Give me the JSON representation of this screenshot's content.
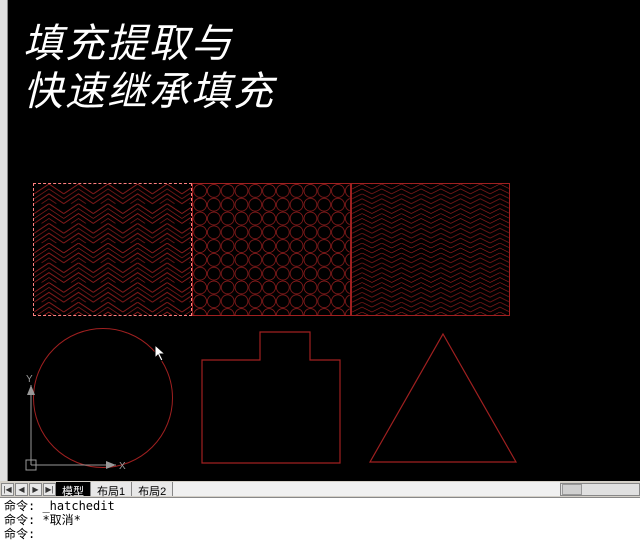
{
  "title": {
    "line1": "填充提取与",
    "line2": "快速继承填充"
  },
  "tabs": {
    "nav": {
      "first": "|◀",
      "prev": "◀",
      "next": "▶",
      "last": "▶|"
    },
    "items": [
      {
        "label": "模型",
        "active": true
      },
      {
        "label": "布局1",
        "active": false
      },
      {
        "label": "布局2",
        "active": false
      }
    ]
  },
  "ucs": {
    "x": "X",
    "y": "Y"
  },
  "command": {
    "line1": "命令: _hatchedit",
    "line2": "命令: *取消*",
    "prompt": "命令:"
  },
  "colors": {
    "hatch": "#a02020",
    "selected": "#ff8080"
  }
}
